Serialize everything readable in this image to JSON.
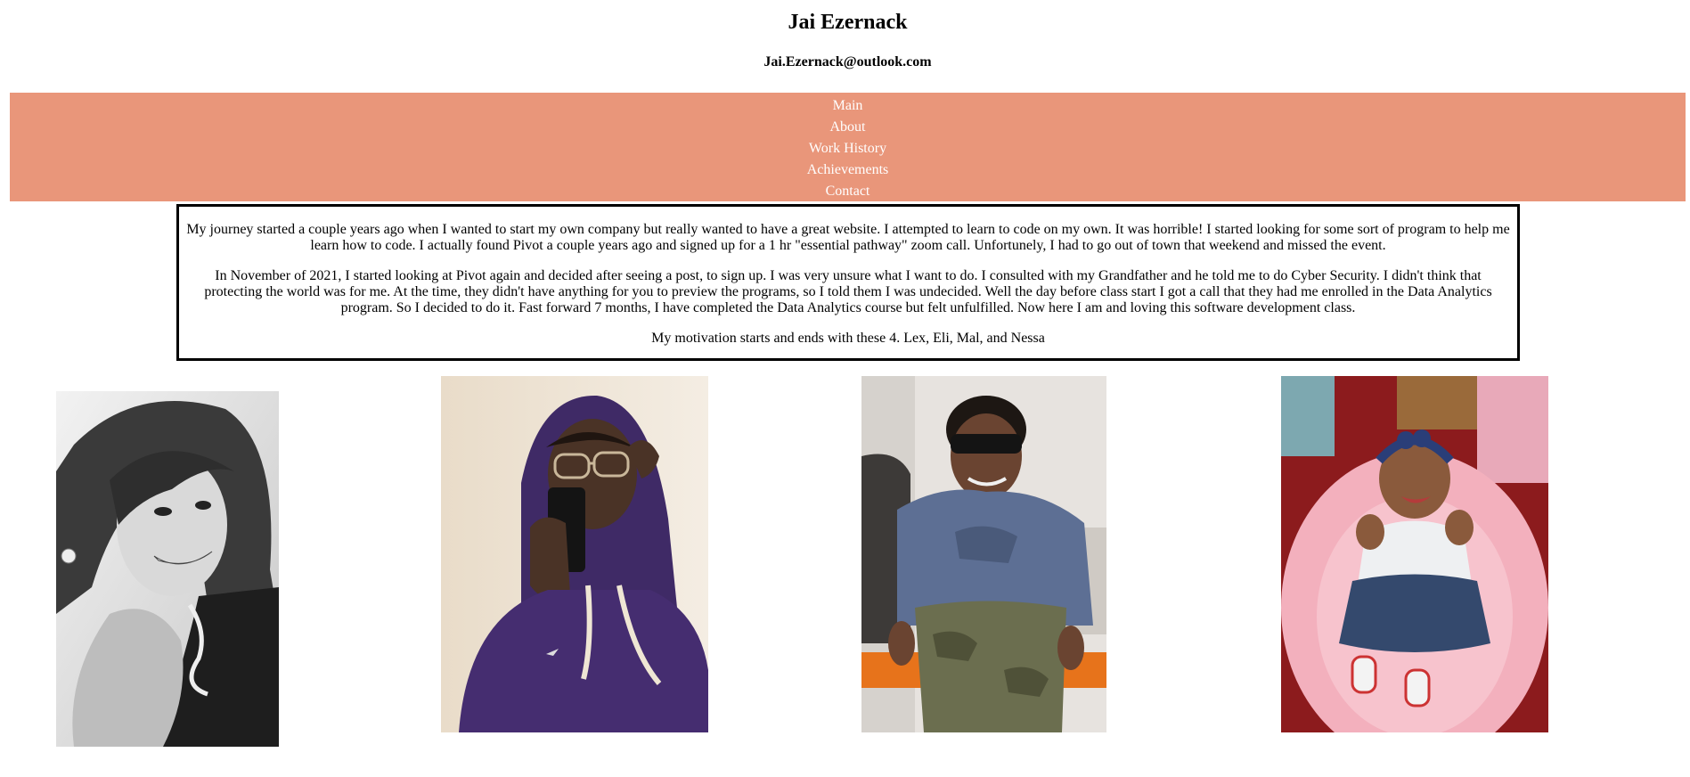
{
  "header": {
    "name": "Jai Ezernack",
    "email": "Jai.Ezernack@outlook.com"
  },
  "nav": {
    "items": [
      {
        "label": "Main"
      },
      {
        "label": "About"
      },
      {
        "label": "Work History"
      },
      {
        "label": "Achievements"
      },
      {
        "label": "Contact"
      }
    ],
    "background_color": "#e9967a",
    "text_color": "#ffffff"
  },
  "story": {
    "paragraphs": [
      "My journey started a couple years ago when I wanted to start my own company but really wanted to have a great website. I attempted to learn to code on my own. It was horrible! I started looking for some sort of program to help me learn how to code. I actually found Pivot a couple years ago and signed up for a 1 hr \"essential pathway\" zoom call. Unfortunely, I had to go out of town that weekend and missed the event.",
      "In November of 2021, I started looking at Pivot again and decided after seeing a post, to sign up. I was very unsure what I want to do. I consulted with my Grandfather and he told me to do Cyber Security. I didn't think that protecting the world was for me. At the time, they didn't have anything for you to preview the programs, so I told them I was undecided. Well the day before class start I got a call that they had me enrolled in the Data Analytics program. So I decided to do it. Fast forward 7 months, I have completed the Data Analytics course but felt unfulfilled. Now here I am and loving this software development class.",
      "My motivation starts and ends with these 4. Lex, Eli, Mal, and Nessa"
    ]
  }
}
